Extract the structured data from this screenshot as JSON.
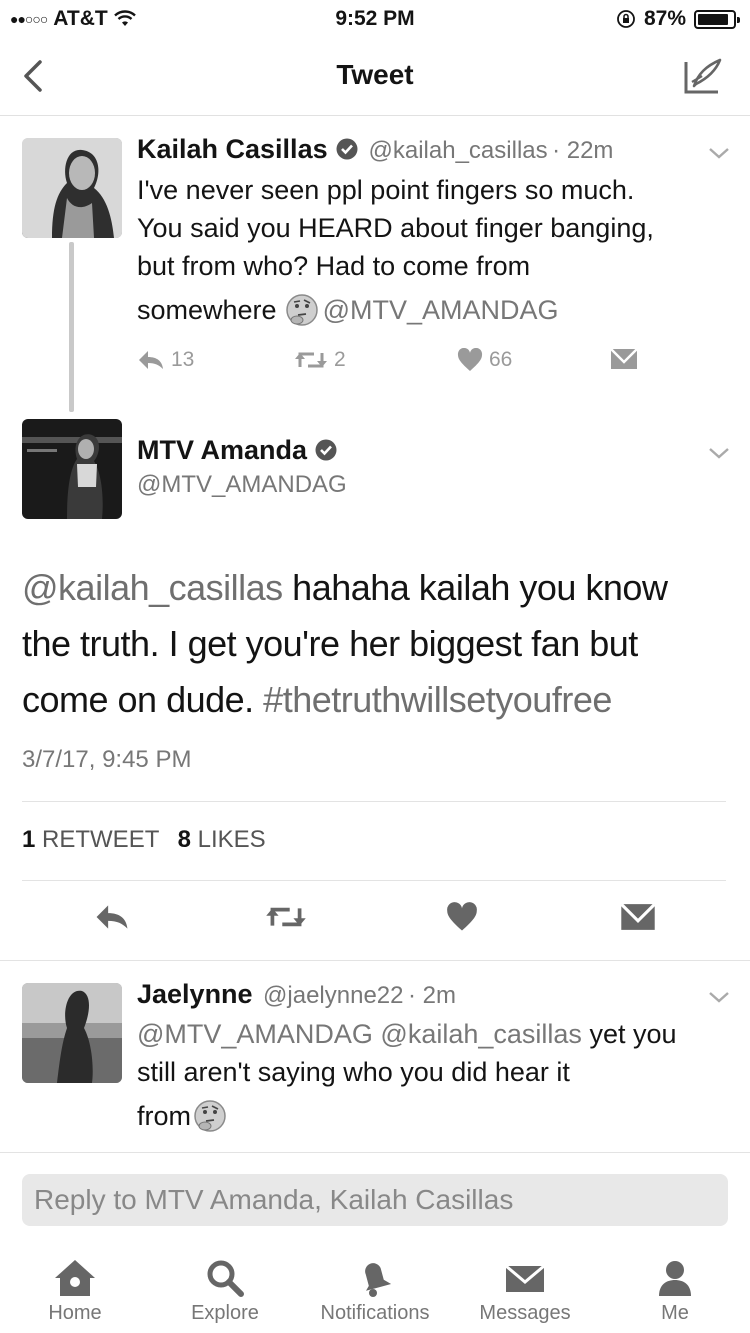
{
  "status": {
    "carrier": "AT&T",
    "time": "9:52 PM",
    "battery": "87%"
  },
  "nav": {
    "title": "Tweet"
  },
  "parent_tweet": {
    "name": "Kailah Casillas",
    "handle": "@kailah_casillas",
    "time": "· 22m",
    "text_lines": [
      "I've never seen ppl point fingers so much.",
      "You said you HEARD about finger banging,",
      "but from who? Had to come from"
    ],
    "last_line_word": "somewhere",
    "last_line_mention": "@MTV_AMANDAG",
    "replies": "13",
    "retweets": "2",
    "likes": "66"
  },
  "main_tweet": {
    "name": "MTV Amanda",
    "handle": "@MTV_AMANDAG",
    "mention": "@kailah_casillas",
    "line1_rest": " hahaha kailah you know",
    "line2": "the truth. I get you're her biggest fan but",
    "line3_text": "come on dude. ",
    "hashtag": "#thetruthwillsetyoufree",
    "timestamp": "3/7/17, 9:45 PM",
    "retweet_count": "1",
    "retweet_label": "RETWEET",
    "like_count": "8",
    "like_label": "LIKES"
  },
  "reply_tweet": {
    "name": "Jaelynne",
    "handle": "@jaelynne22",
    "time": "· 2m",
    "mentions": "@MTV_AMANDAG @kailah_casillas",
    "line1_rest": " yet you",
    "line2": "still aren't saying who you did hear it",
    "line3": "from"
  },
  "reply_box": {
    "placeholder": "Reply to MTV Amanda, Kailah Casillas"
  },
  "tabs": [
    {
      "label": "Home",
      "icon": "home-icon"
    },
    {
      "label": "Explore",
      "icon": "search-icon"
    },
    {
      "label": "Notifications",
      "icon": "bell-icon"
    },
    {
      "label": "Messages",
      "icon": "envelope-icon"
    },
    {
      "label": "Me",
      "icon": "person-icon"
    }
  ]
}
